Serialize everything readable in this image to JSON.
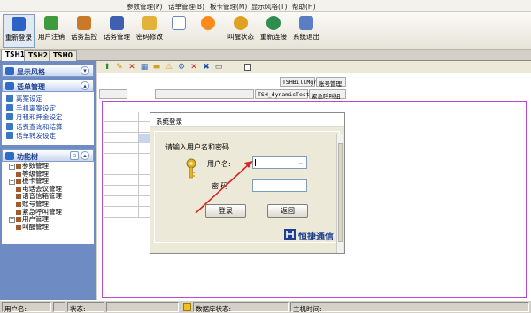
{
  "menubar": {
    "items": [
      "参数管理(P)",
      "话单管理(B)",
      "板卡管理(M)",
      "显示风格(T)",
      "帮助(H)"
    ]
  },
  "toolbar": {
    "buttons": [
      {
        "label": "重新登录",
        "icon": "relogin-icon"
      },
      {
        "label": "用户注销",
        "icon": "user-logout-icon"
      },
      {
        "label": "话务监控",
        "icon": "call-monitor-icon"
      },
      {
        "label": "话务管理",
        "icon": "call-manage-icon"
      },
      {
        "label": "密码修改",
        "icon": "key-icon"
      },
      {
        "label": "",
        "icon": "document-icon"
      },
      {
        "label": "",
        "icon": "runner-icon"
      },
      {
        "label": "叫醒状态",
        "icon": "alarm-clock-icon"
      },
      {
        "label": "重新连接",
        "icon": "globe-icon"
      },
      {
        "label": "系统退出",
        "icon": "exit-icon"
      }
    ]
  },
  "tabs": [
    "TSH1",
    "TSH2",
    "TSH0"
  ],
  "sidebar": {
    "style_panel": {
      "title": "显示风格"
    },
    "bill_panel": {
      "title": "话单管理",
      "links": [
        "离案设定",
        "手机离案设定",
        "月租和押金设定",
        "话费查询和结算",
        "话单转发设定"
      ]
    },
    "tree_panel": {
      "title": "功能树",
      "nodes": [
        {
          "label": "参数管理",
          "expand": "+"
        },
        {
          "label": "等级管理",
          "expand": ""
        },
        {
          "label": "板卡管理",
          "expand": "+"
        },
        {
          "label": "电话会议管理",
          "expand": ""
        },
        {
          "label": "语音信箱管理",
          "expand": ""
        },
        {
          "label": "账号管理",
          "expand": ""
        },
        {
          "label": "紧急呼叫管理",
          "expand": ""
        },
        {
          "label": "用户管理",
          "expand": "+"
        },
        {
          "label": "叫醒管理",
          "expand": ""
        }
      ]
    }
  },
  "main": {
    "headers": {
      "bill_mgr": "TSHBillMgr",
      "account_mgr": "账号管理",
      "dynamic_test": "TSH_dynamicTest",
      "emergency_group": "紧急呼叫组"
    }
  },
  "dialog": {
    "title": "系统登录",
    "prompt": "请输入用户名和密码",
    "username_label": "用户名:",
    "username_value": "",
    "password_label": "密  码",
    "password_value": "",
    "login_button": "登录",
    "back_button": "返回",
    "brand": "恒捷通信"
  },
  "statusbar": {
    "user_label": "用户名:",
    "state_label": "状态:",
    "db_state_label": "数据库状态:",
    "host_time_label": "主机时间:"
  },
  "colors": {
    "sidebar_bg": "#6f8bc3",
    "frame_purple": "#b84ad0",
    "arrow_red": "#d42424",
    "brand_blue": "#1f3f8f"
  }
}
